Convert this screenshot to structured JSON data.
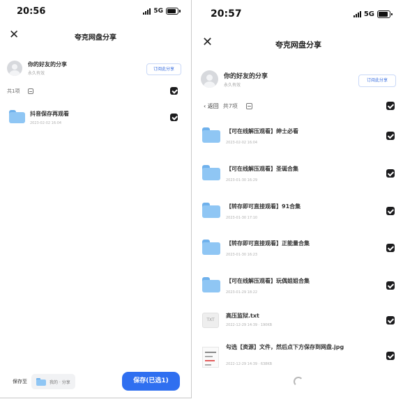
{
  "left": {
    "status_bar": {
      "time": "20:56",
      "network": "5G",
      "battery_level": 0.8
    },
    "header": {
      "title": "夸克网盘分享"
    },
    "owner": {
      "name": "你的好友的分享",
      "validity": "永久有效"
    },
    "save_share_label": "订阅此分享",
    "toolbar": {
      "count": "共1项"
    },
    "items": [
      {
        "name": "抖音保存再观看",
        "date": "2023-02-02 16:04",
        "icon": "folder-icon",
        "checked": true
      }
    ],
    "footer": {
      "save_to_label": "保存至",
      "path": "我的 · 分享",
      "save_button": "保存(已选1)"
    }
  },
  "right": {
    "status_bar": {
      "time": "20:57",
      "network": "5G",
      "battery_level": 0.8
    },
    "header": {
      "title": "夸克网盘分享"
    },
    "owner": {
      "name": "你的好友的分享",
      "validity": "永久有效"
    },
    "save_share_label": "订阅此分享",
    "toolbar": {
      "back": "返回",
      "count": "共7项"
    },
    "items": [
      {
        "name": "【可在线解压观看】绅士必看",
        "date": "2023-02-02 16:04",
        "icon": "folder-icon",
        "checked": true
      },
      {
        "name": "【可在线解压观看】圣诞合集",
        "date": "2023-01-30 16:29",
        "icon": "folder-icon",
        "checked": true
      },
      {
        "name": "【转存即可直接观看】91合集",
        "date": "2023-01-30 17:10",
        "icon": "folder-icon",
        "checked": true
      },
      {
        "name": "【转存即可直接观看】正能量合集",
        "date": "2023-01-30 16:23",
        "icon": "folder-icon",
        "checked": true
      },
      {
        "name": "【可在线解压观看】玩偶姐姐合集",
        "date": "2023-01-29 18:22",
        "icon": "folder-icon",
        "checked": true
      },
      {
        "name": "高压监狱.txt",
        "date": "2022-12-29 14:39 · 190KB",
        "icon": "txt-file-icon",
        "icon_label": "TXT",
        "checked": true
      },
      {
        "name": "勾选【资源】文件，然后点下方保存到网盘.jpg",
        "date": "2022-12-29 14:39 · 638KB",
        "icon": "image-file-icon",
        "checked": true
      }
    ]
  }
}
